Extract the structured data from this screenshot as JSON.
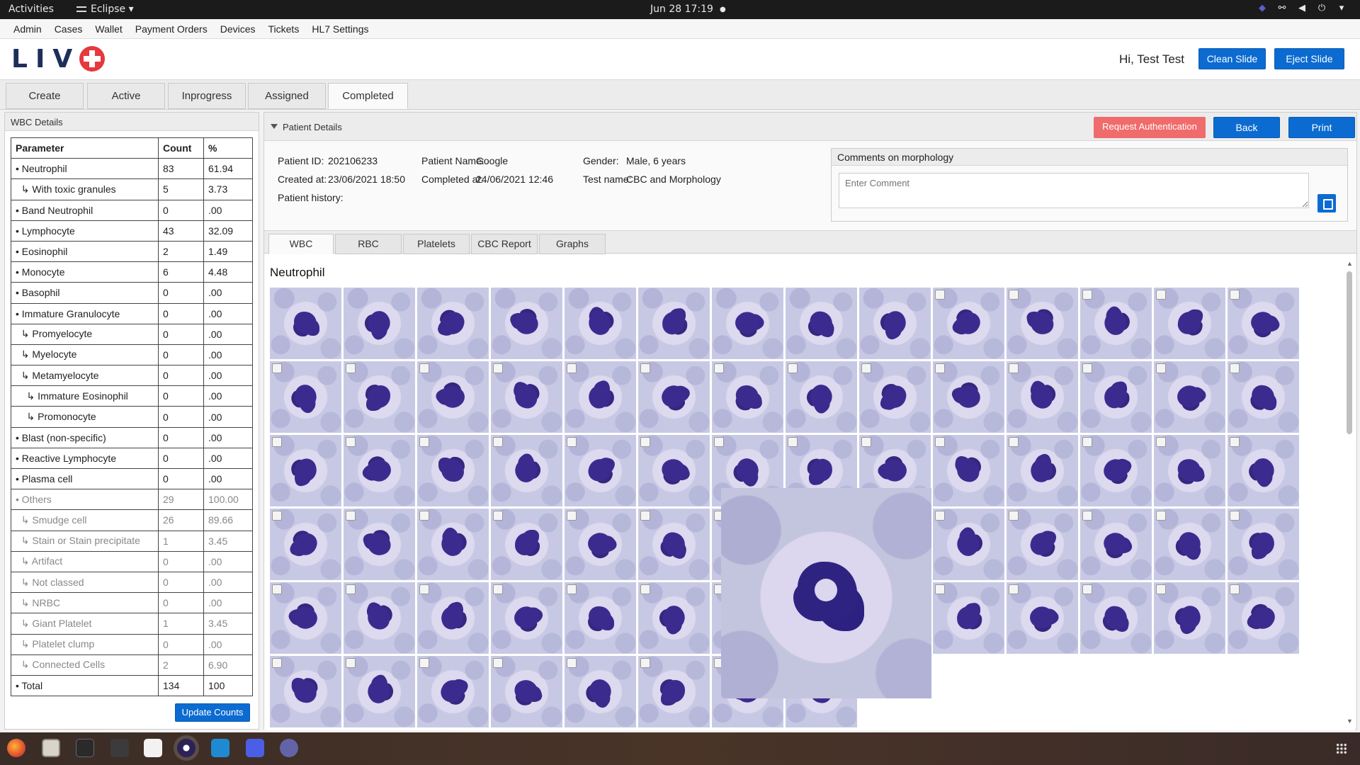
{
  "topbar": {
    "activities": "Activities",
    "app_name": "Eclipse",
    "datetime": "Jun 28  17:19"
  },
  "menu": [
    "Admin",
    "Cases",
    "Wallet",
    "Payment Orders",
    "Devices",
    "Tickets",
    "HL7 Settings"
  ],
  "header": {
    "logo_text": "LIV",
    "greeting": "Hi, Test Test",
    "clean_slide": "Clean Slide",
    "eject_slide": "Eject Slide"
  },
  "main_tabs": [
    "Create",
    "Active",
    "Inprogress",
    "Assigned",
    "Completed"
  ],
  "wbc": {
    "title": "WBC Details",
    "headers": [
      "Parameter",
      "Count",
      "%"
    ],
    "rows": [
      {
        "param": "• Neutrophil",
        "count": "83",
        "pct": "61.94"
      },
      {
        "param": "  ↳ With toxic granules",
        "count": "5",
        "pct": "3.73"
      },
      {
        "param": "• Band Neutrophil",
        "count": "0",
        "pct": ".00"
      },
      {
        "param": "• Lymphocyte",
        "count": "43",
        "pct": "32.09"
      },
      {
        "param": "• Eosinophil",
        "count": "2",
        "pct": "1.49"
      },
      {
        "param": "• Monocyte",
        "count": "6",
        "pct": "4.48"
      },
      {
        "param": "• Basophil",
        "count": "0",
        "pct": ".00"
      },
      {
        "param": "• Immature Granulocyte",
        "count": "0",
        "pct": ".00"
      },
      {
        "param": "  ↳ Promyelocyte",
        "count": "0",
        "pct": ".00"
      },
      {
        "param": "  ↳ Myelocyte",
        "count": "0",
        "pct": ".00"
      },
      {
        "param": "  ↳ Metamyelocyte",
        "count": "0",
        "pct": ".00"
      },
      {
        "param": "    ↳ Immature Eosinophil",
        "count": "0",
        "pct": ".00"
      },
      {
        "param": "    ↳ Promonocyte",
        "count": "0",
        "pct": ".00"
      },
      {
        "param": "• Blast (non-specific)",
        "count": "0",
        "pct": ".00"
      },
      {
        "param": "• Reactive Lymphocyte",
        "count": "0",
        "pct": ".00"
      },
      {
        "param": "• Plasma cell",
        "count": "0",
        "pct": ".00"
      },
      {
        "param": "• Others",
        "count": "29",
        "pct": "100.00",
        "muted": true
      },
      {
        "param": "  ↳ Smudge cell",
        "count": "26",
        "pct": "89.66",
        "muted": true
      },
      {
        "param": "  ↳ Stain or Stain precipitate",
        "count": "1",
        "pct": "3.45",
        "muted": true
      },
      {
        "param": "  ↳ Artifact",
        "count": "0",
        "pct": ".00",
        "muted": true
      },
      {
        "param": "  ↳ Not classed",
        "count": "0",
        "pct": ".00",
        "muted": true
      },
      {
        "param": "  ↳ NRBC",
        "count": "0",
        "pct": ".00",
        "muted": true
      },
      {
        "param": "  ↳ Giant Platelet",
        "count": "1",
        "pct": "3.45",
        "muted": true
      },
      {
        "param": "  ↳ Platelet clump",
        "count": "0",
        "pct": ".00",
        "muted": true
      },
      {
        "param": "  ↳ Connected Cells",
        "count": "2",
        "pct": "6.90",
        "muted": true
      },
      {
        "param": "• Total",
        "count": "134",
        "pct": "100"
      }
    ],
    "update_button": "Update Counts"
  },
  "patient": {
    "section_title": "Patient Details",
    "request_auth": "Request Authentication",
    "back": "Back",
    "print": "Print",
    "id_label": "Patient ID:",
    "id": "202106233",
    "name_label": "Patient Name:",
    "name": "Google",
    "gender_label": "Gender:",
    "gender": "Male, 6 years",
    "created_label": "Created at:",
    "created": "23/06/2021 18:50",
    "completed_label": "Completed at:",
    "completed": "24/06/2021 12:46",
    "test_label": "Test name:",
    "test": "CBC and Morphology",
    "history_label": "Patient history:",
    "comments_title": "Comments on morphology",
    "comment_placeholder": "Enter Comment"
  },
  "sub_tabs": [
    "WBC",
    "RBC",
    "Platelets",
    "CBC Report",
    "Graphs"
  ],
  "cells": {
    "heading": "Neutrophil",
    "rows": 6,
    "cols": 14,
    "last_row_count": 8
  },
  "colors": {
    "primary_blue": "#0b6bd1",
    "request_red": "#f06b6b",
    "logo_navy": "#1d2e5a",
    "logo_red": "#e5393d"
  }
}
